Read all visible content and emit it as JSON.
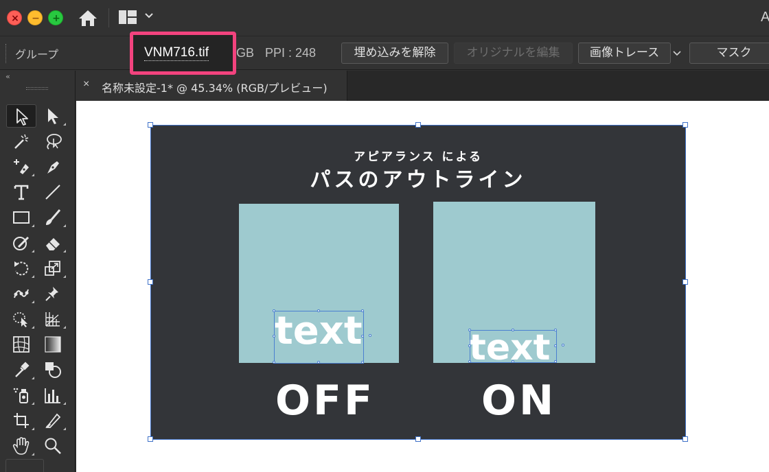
{
  "titlebar": {
    "window_buttons": [
      {
        "name": "close",
        "glyph": "×",
        "color": "#fd5f57"
      },
      {
        "name": "minimize",
        "glyph": "−",
        "color": "#febc2e"
      },
      {
        "name": "maximize",
        "glyph": "+",
        "color": "#28c840"
      }
    ],
    "home_icon": "home-icon",
    "workspace_icon": "workspace-layout-icon",
    "cutoff_text": "A"
  },
  "controlbar": {
    "selection_type": "グループ",
    "linked_file": "VNM716.tif",
    "color_mode": "GB",
    "ppi": "PPI : 248",
    "buttons": {
      "unembed": "埋め込みを解除",
      "edit_original": "オリジナルを編集",
      "image_trace": "画像トレース",
      "mask": "マスク"
    },
    "highlight_color": "#f2437e"
  },
  "toolbar": {
    "collapse": "‹‹",
    "tools": [
      "selection-tool",
      "direct-selection-tool",
      "magic-wand-tool",
      "lasso-tool",
      "curvature-pen-tool",
      "pen-tool",
      "type-tool",
      "line-segment-tool",
      "rectangle-tool",
      "paintbrush-tool",
      "shaper-tool",
      "eraser-tool",
      "rotate-tool",
      "scale-tool",
      "puppet-warp-tool",
      "pin-tool",
      "shape-builder-tool",
      "perspective-grid-tool",
      "mesh-tool",
      "gradient-tool",
      "eyedropper-tool",
      "blend-tool",
      "symbol-sprayer-tool",
      "column-graph-tool",
      "artboard-tool",
      "slice-tool",
      "hand-tool",
      "zoom-tool"
    ]
  },
  "document": {
    "tab_close": "×",
    "tab_title": "名称未設定-1* @ 45.34% (RGB/プレビュー)"
  },
  "artwork": {
    "subtitle": "アピアランス による",
    "title": "パスのアウトライン",
    "sample_text": "text",
    "label_off": "OFF",
    "label_on": "ON",
    "colors": {
      "artboard_bg": "#333539",
      "sample_fill": "#9ecacf",
      "text": "#ffffff",
      "selection": "#3f72c9"
    }
  }
}
